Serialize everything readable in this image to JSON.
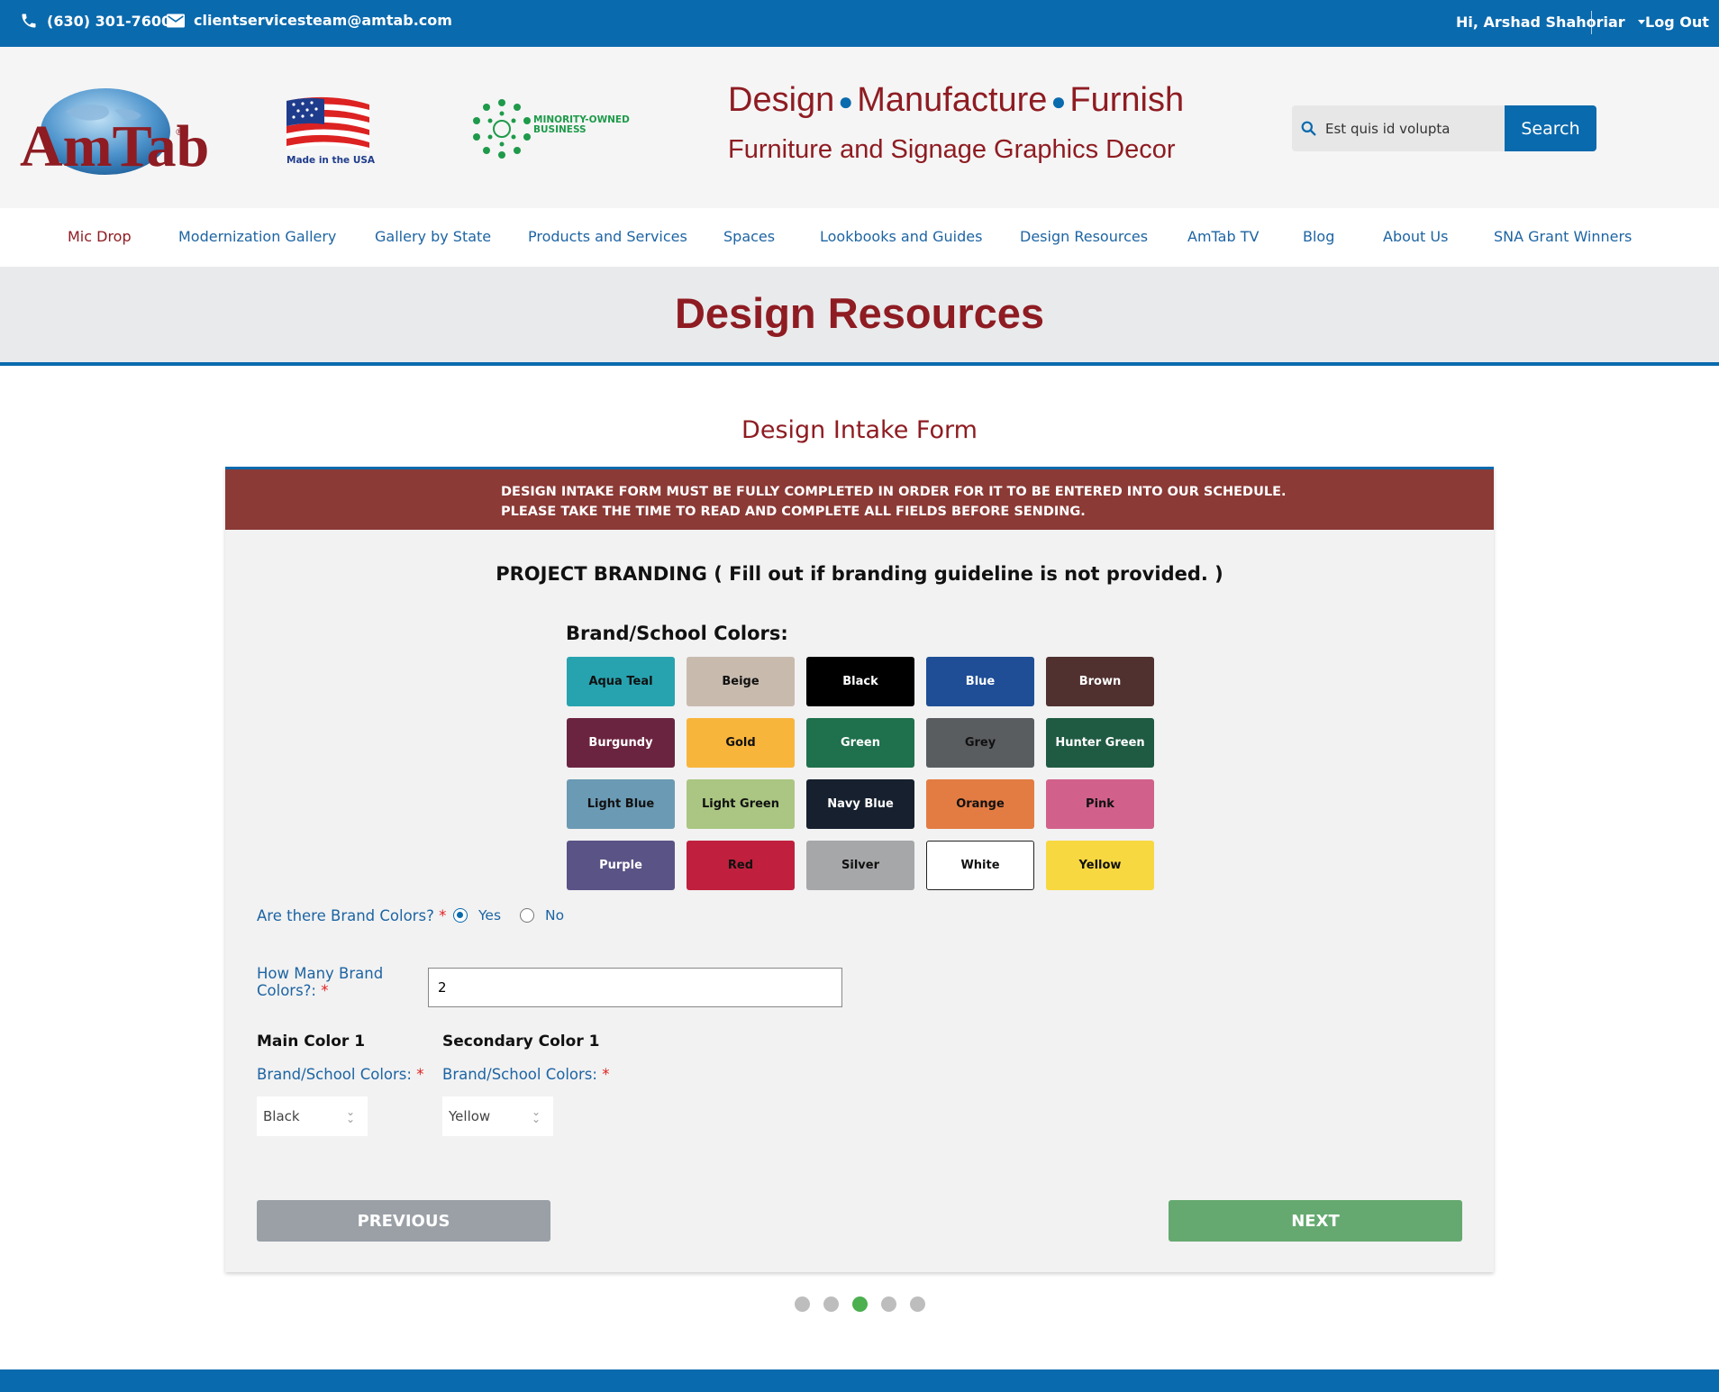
{
  "topbar": {
    "phone": "(630) 301-7600",
    "email": "clientservicesteam@amtab.com",
    "greeting": "Hi, Arshad Shahoriar",
    "logout": "Log Out"
  },
  "header": {
    "logo_text": "AmTab",
    "logo_mark": "®",
    "usa_caption": "Made in the USA",
    "mob_line1": "MINORITY-OWNED",
    "mob_line2": "BUSINESS",
    "tagline_words": [
      "Design",
      "Manufacture",
      "Furnish"
    ],
    "tagline_sub": "Furniture and Signage Graphics Decor",
    "search_value": "Est quis id volupta",
    "search_button": "Search"
  },
  "nav": {
    "items": [
      "Mic Drop",
      "Modernization Gallery",
      "Gallery by State",
      "Products and Services",
      "Spaces",
      "Lookbooks and Guides",
      "Design Resources",
      "AmTab TV",
      "Blog",
      "About Us",
      "SNA Grant Winners"
    ]
  },
  "page_title": "Design Resources",
  "form": {
    "heading": "Design Intake Form",
    "warning_line1": "DESIGN INTAKE FORM MUST BE FULLY COMPLETED IN ORDER FOR IT TO BE ENTERED INTO OUR SCHEDULE.",
    "warning_line2": "PLEASE TAKE THE TIME TO READ AND COMPLETE ALL FIELDS BEFORE SENDING.",
    "section_title": "PROJECT BRANDING ( Fill out if branding guideline is not provided. )",
    "colors_title": "Brand/School Colors:",
    "swatches": [
      {
        "name": "Aqua Teal",
        "bg": "#27a3b0",
        "fg": "#111111"
      },
      {
        "name": "Beige",
        "bg": "#c8bbae",
        "fg": "#111111"
      },
      {
        "name": "Black",
        "bg": "#000000",
        "fg": "#ffffff"
      },
      {
        "name": "Blue",
        "bg": "#1f4e96",
        "fg": "#ffffff"
      },
      {
        "name": "Brown",
        "bg": "#503130",
        "fg": "#ffffff"
      },
      {
        "name": "Burgundy",
        "bg": "#6b2440",
        "fg": "#ffffff"
      },
      {
        "name": "Gold",
        "bg": "#f8b53c",
        "fg": "#111111"
      },
      {
        "name": "Green",
        "bg": "#1f704c",
        "fg": "#ffffff"
      },
      {
        "name": "Grey",
        "bg": "#5a5d60",
        "fg": "#111111"
      },
      {
        "name": "Hunter Green",
        "bg": "#1f5a43",
        "fg": "#ffffff"
      },
      {
        "name": "Light Blue",
        "bg": "#6b9ab4",
        "fg": "#111111"
      },
      {
        "name": "Light Green",
        "bg": "#aac682",
        "fg": "#111111"
      },
      {
        "name": "Navy Blue",
        "bg": "#16202e",
        "fg": "#ffffff"
      },
      {
        "name": "Orange",
        "bg": "#e37c43",
        "fg": "#111111"
      },
      {
        "name": "Pink",
        "bg": "#d1618b",
        "fg": "#111111"
      },
      {
        "name": "Purple",
        "bg": "#5a5386",
        "fg": "#ffffff"
      },
      {
        "name": "Red",
        "bg": "#c0203d",
        "fg": "#111111"
      },
      {
        "name": "Silver",
        "bg": "#a6a7a9",
        "fg": "#111111"
      },
      {
        "name": "White",
        "bg": "#ffffff",
        "fg": "#111111"
      },
      {
        "name": "Yellow",
        "bg": "#f8d840",
        "fg": "#111111"
      }
    ],
    "brand_colors_q": "Are there Brand Colors?",
    "yes": "Yes",
    "no": "No",
    "how_many_q": "How Many Brand Colors?:",
    "how_many_value": "2",
    "main_color_h": "Main Color 1",
    "secondary_color_h": "Secondary Color 1",
    "main_color_label": "Brand/School Colors:",
    "secondary_color_label": "Brand/School Colors:",
    "main_color_value": "Black",
    "secondary_color_value": "Yellow",
    "required_mark": "*",
    "previous": "PREVIOUS",
    "next": "NEXT"
  },
  "colors": {
    "brand_blue": "#0a6aae",
    "brand_red": "#8e1c22",
    "warning_bg": "#8b3a36",
    "next_green": "#65a970",
    "step_active": "#4caf50"
  }
}
